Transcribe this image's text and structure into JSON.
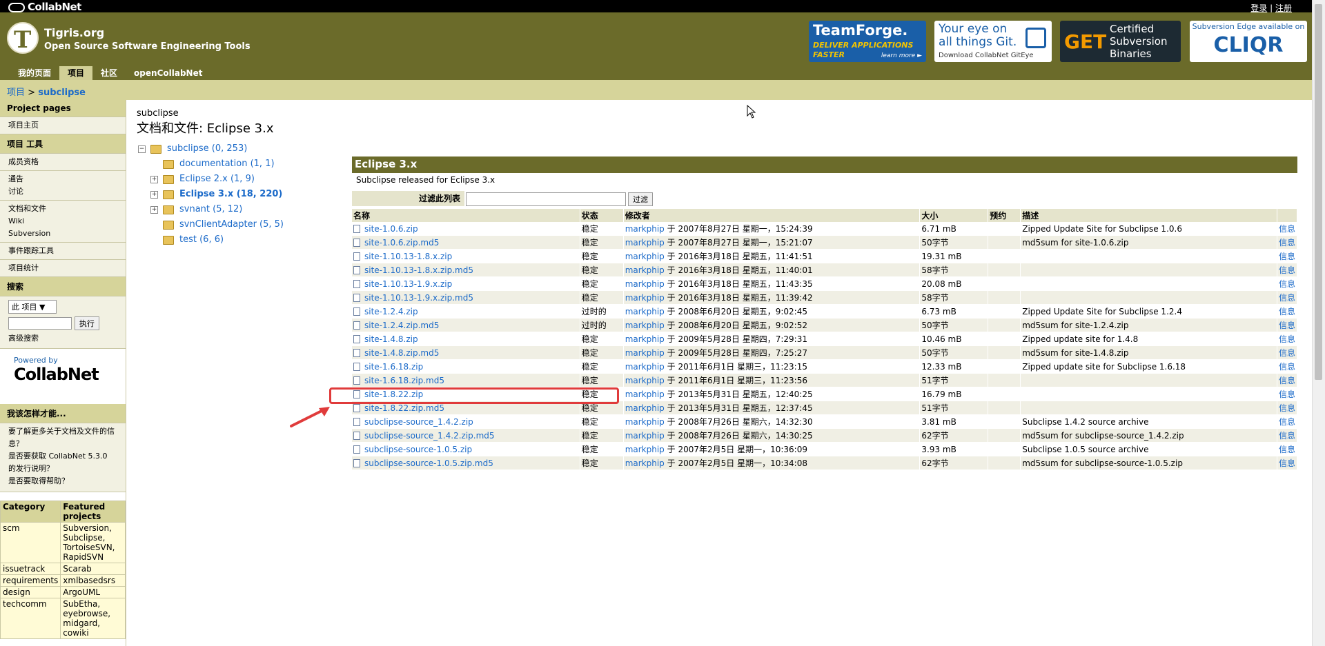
{
  "topbar": {
    "logo": "CollabNet",
    "login": "登录",
    "sep": "|",
    "register": "注册"
  },
  "header": {
    "site_title": "Tigris.org",
    "site_sub": "Open Source Software Engineering Tools",
    "nav": [
      "我的页面",
      "项目",
      "社区",
      "openCollabNet"
    ],
    "ads": {
      "teamforge": {
        "title": "TeamForge.",
        "line1": "DELIVER APPLICATIONS",
        "line2": "FASTER",
        "cta": "learn more ►"
      },
      "gitEye": {
        "title": "Your eye on all things Git.",
        "sub": "Download CollabNet GitEye"
      },
      "subversion": {
        "get": "GET",
        "text": "Certified Subversion Binaries"
      },
      "cliqr": {
        "line": "Subversion Edge available on",
        "brand": "CLIQR"
      }
    }
  },
  "breadcrumb": {
    "root": "项目",
    "sep": ">",
    "current": "subclipse"
  },
  "sidebar": {
    "project_pages_title": "Project pages",
    "project_home": "项目主页",
    "tools_title": "项目 工具",
    "membership": "成员资格",
    "announcements": "通告",
    "discussions": "讨论",
    "docs_files": "文档和文件",
    "wiki": "Wiki",
    "subversion": "Subversion",
    "issue_tracker": "事件跟踪工具",
    "project_stats": "项目统计",
    "search_title": "搜索",
    "search_scope": "此 项目",
    "search_button": "执行",
    "advanced_search": "高级搜索",
    "powered_by": "Powered by",
    "powered_brand": "CollabNet",
    "howto_title": "我该怎样才能...",
    "howto_items": [
      "要了解更多关于文档及文件的信息？",
      "是否要获取 CollabNet 5.3.0 的发行说明？",
      "是否要取得帮助？"
    ],
    "featured_header": [
      "Category",
      "Featured projects"
    ],
    "featured_rows": [
      [
        "scm",
        "Subversion, Subclipse, TortoiseSVN, RapidSVN"
      ],
      [
        "issuetrack",
        "Scarab"
      ],
      [
        "requirements",
        "xmlbasedsrs"
      ],
      [
        "design",
        "ArgoUML"
      ],
      [
        "techcomm",
        "SubEtha, eyebrowse, midgard, cowiki"
      ]
    ]
  },
  "main": {
    "project_name": "subclipse",
    "title": "文档和文件: Eclipse 3.x",
    "tree": [
      {
        "label": "subclipse (0, 253)",
        "toggle": "−"
      },
      {
        "label": "documentation (1, 1)",
        "toggle": ""
      },
      {
        "label": "Eclipse 2.x (1, 9)",
        "toggle": "+"
      },
      {
        "label": "Eclipse 3.x (18, 220)",
        "toggle": "+"
      },
      {
        "label": "svnant (5, 12)",
        "toggle": "+"
      },
      {
        "label": "svnClientAdapter (5, 5)",
        "toggle": ""
      },
      {
        "label": "test (6, 6)",
        "toggle": ""
      }
    ],
    "folder_title": "Eclipse 3.x",
    "folder_desc": "Subclipse released for Eclipse 3.x",
    "filter_label": "过滤此列表",
    "filter_button": "过滤",
    "columns": [
      "名称",
      "状态",
      "修改者",
      "大小",
      "预约",
      "描述",
      ""
    ],
    "files": [
      [
        "site-1.0.6.zip",
        "稳定",
        "markphip",
        "于 2007年8月27日 星期一，15:24:39",
        "6.71 mB",
        "",
        "Zipped Update Site for Subclipse 1.0.6",
        "信息"
      ],
      [
        "site-1.0.6.zip.md5",
        "稳定",
        "markphip",
        "于 2007年8月27日 星期一，15:21:07",
        "50字节",
        "",
        "md5sum for site-1.0.6.zip",
        "信息"
      ],
      [
        "site-1.10.13-1.8.x.zip",
        "稳定",
        "markphip",
        "于 2016年3月18日 星期五，11:41:51",
        "19.31 mB",
        "",
        "",
        "信息"
      ],
      [
        "site-1.10.13-1.8.x.zip.md5",
        "稳定",
        "markphip",
        "于 2016年3月18日 星期五，11:40:01",
        "58字节",
        "",
        "",
        "信息"
      ],
      [
        "site-1.10.13-1.9.x.zip",
        "稳定",
        "markphip",
        "于 2016年3月18日 星期五，11:43:35",
        "20.08 mB",
        "",
        "",
        "信息"
      ],
      [
        "site-1.10.13-1.9.x.zip.md5",
        "稳定",
        "markphip",
        "于 2016年3月18日 星期五，11:39:42",
        "58字节",
        "",
        "",
        "信息"
      ],
      [
        "site-1.2.4.zip",
        "过时的",
        "markphip",
        "于 2008年6月20日 星期五，9:02:45",
        "6.73 mB",
        "",
        "Zipped Update Site for Subclipse 1.2.4",
        "信息"
      ],
      [
        "site-1.2.4.zip.md5",
        "过时的",
        "markphip",
        "于 2008年6月20日 星期五，9:02:52",
        "50字节",
        "",
        "md5sum for site-1.2.4.zip",
        "信息"
      ],
      [
        "site-1.4.8.zip",
        "稳定",
        "markphip",
        "于 2009年5月28日 星期四，7:29:31",
        "10.46 mB",
        "",
        "Zipped update site for 1.4.8",
        "信息"
      ],
      [
        "site-1.4.8.zip.md5",
        "稳定",
        "markphip",
        "于 2009年5月28日 星期四，7:25:27",
        "50字节",
        "",
        "md5sum for site-1.4.8.zip",
        "信息"
      ],
      [
        "site-1.6.18.zip",
        "稳定",
        "markphip",
        "于 2011年6月1日 星期三，11:23:15",
        "12.33 mB",
        "",
        "Zipped update site for Subclipse 1.6.18",
        "信息"
      ],
      [
        "site-1.6.18.zip.md5",
        "稳定",
        "markphip",
        "于 2011年6月1日 星期三，11:23:56",
        "51字节",
        "",
        "",
        "信息"
      ],
      [
        "site-1.8.22.zip",
        "稳定",
        "markphip",
        "于 2013年5月31日 星期五，12:40:25",
        "16.79 mB",
        "",
        "",
        "信息"
      ],
      [
        "site-1.8.22.zip.md5",
        "稳定",
        "markphip",
        "于 2013年5月31日 星期五，12:37:45",
        "51字节",
        "",
        "",
        "信息"
      ],
      [
        "subclipse-source_1.4.2.zip",
        "稳定",
        "markphip",
        "于 2008年7月26日 星期六，14:32:30",
        "3.81 mB",
        "",
        "Subclipse 1.4.2 source archive",
        "信息"
      ],
      [
        "subclipse-source_1.4.2.zip.md5",
        "稳定",
        "markphip",
        "于 2008年7月26日 星期六，14:30:25",
        "62字节",
        "",
        "md5sum for subclipse-source_1.4.2.zip",
        "信息"
      ],
      [
        "subclipse-source-1.0.5.zip",
        "稳定",
        "markphip",
        "于 2007年2月5日 星期一，10:36:09",
        "3.93 mB",
        "",
        "Subclipse 1.0.5 source archive",
        "信息"
      ],
      [
        "subclipse-source-1.0.5.zip.md5",
        "稳定",
        "markphip",
        "于 2007年2月5日 星期一，10:34:08",
        "62字节",
        "",
        "md5sum for subclipse-source-1.0.5.zip",
        "信息"
      ]
    ]
  },
  "colors": {
    "olive": "#6b6b2a",
    "khaki": "#d6d49a",
    "link": "#1b6ac9",
    "highlight": "#e03b3b"
  }
}
